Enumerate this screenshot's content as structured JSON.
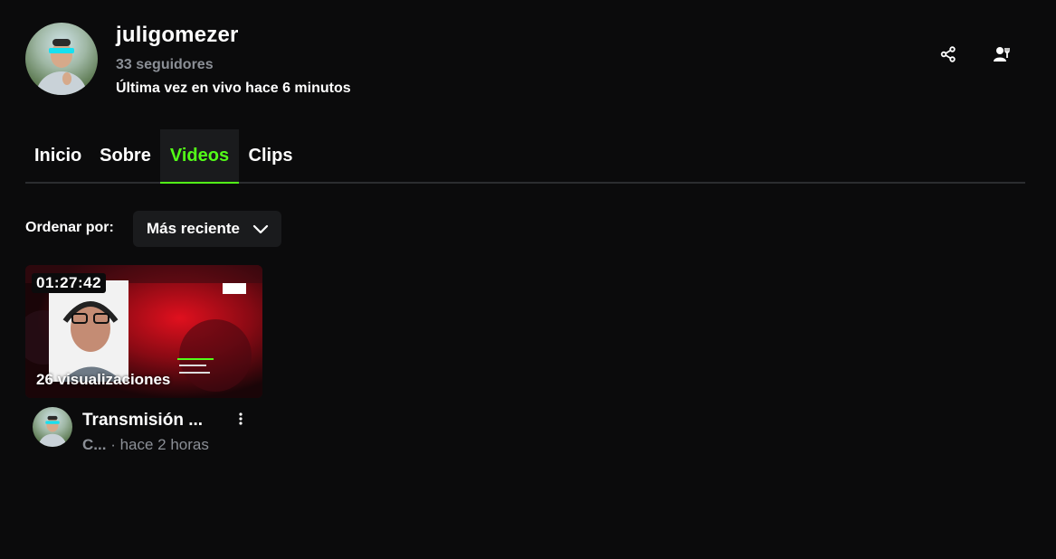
{
  "channel": {
    "name": "juligomezer",
    "followers": "33 seguidores",
    "last_live": "Última vez en vivo hace 6 minutos"
  },
  "actions": {
    "share_icon": "share-icon",
    "profile_icon": "user-settings-icon"
  },
  "tabs": [
    {
      "label": "Inicio",
      "active": false
    },
    {
      "label": "Sobre",
      "active": false
    },
    {
      "label": "Videos",
      "active": true
    },
    {
      "label": "Clips",
      "active": false
    }
  ],
  "sort": {
    "label": "Ordenar por:",
    "selected": "Más reciente"
  },
  "videos": [
    {
      "duration": "01:27:42",
      "views": "26 visualizaciones",
      "title": "Transmisión ...",
      "category": "C...",
      "time_ago": "· hace 2 horas"
    }
  ],
  "colors": {
    "background": "#0b0b0c",
    "accent": "#53fc18",
    "muted": "#8b8f96",
    "surface": "#1a1b1d"
  }
}
